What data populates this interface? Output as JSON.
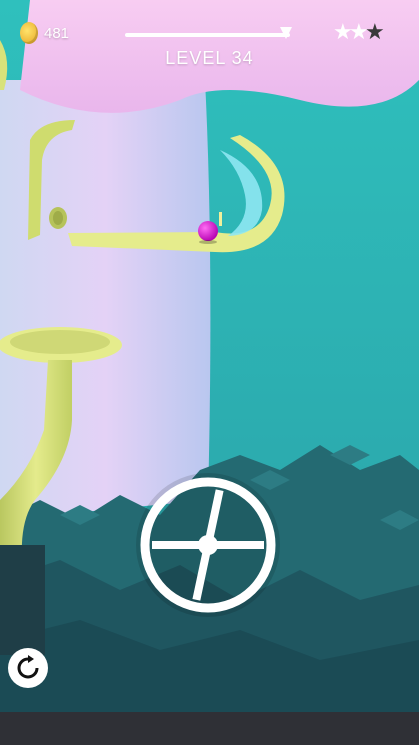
{
  "hud": {
    "coins": "481",
    "level_label": "LEVEL 34",
    "progress": 0.94,
    "stars_earned": 2,
    "stars_total": 3
  },
  "icons": {
    "coin": "coin-icon",
    "star": "star-icon",
    "restart": "restart-icon",
    "ball": "ball",
    "wheel": "rotate-wheel"
  },
  "colors": {
    "sky": "#2fb3b2",
    "tower": "#d9c7f2",
    "pink_cap": "#f3c6f0",
    "track": "#e5ec8c",
    "ball": "#e21bd9",
    "dark_cubes": "#1f5b66",
    "water_slide": "#8ee7f2"
  },
  "actions": {
    "restart": "restart"
  }
}
